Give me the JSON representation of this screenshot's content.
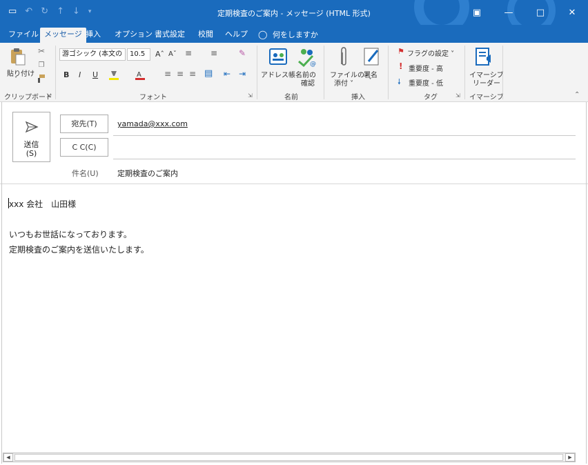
{
  "window": {
    "title": "定期検査のご案内 - メッセージ (HTML 形式)",
    "quick_access": {
      "save_icon": "save-icon",
      "undo_icon": "undo-icon",
      "redo_icon": "redo-icon",
      "up_icon": "arrow-up-icon",
      "down_icon": "arrow-down-icon",
      "customize_icon": "customize-icon"
    },
    "controls": {
      "ribbon_display": "ribbon-display-icon",
      "minimize": "minimize-icon",
      "maximize": "maximize-icon",
      "close": "close-icon"
    }
  },
  "menu": {
    "tabs": [
      {
        "label": "ファイル",
        "active": false
      },
      {
        "label": "メッセージ",
        "active": true
      },
      {
        "label": "挿入",
        "active": false
      },
      {
        "label": "オプション",
        "active": false
      },
      {
        "label": "書式設定",
        "active": false
      },
      {
        "label": "校閲",
        "active": false
      },
      {
        "label": "ヘルプ",
        "active": false
      }
    ],
    "tell_me": "何をしますか"
  },
  "ribbon": {
    "clipboard": {
      "paste": "貼り付け",
      "group": "クリップボード"
    },
    "font": {
      "font_name": "游ゴシック (本文の",
      "font_size": "10.5",
      "bold": "B",
      "italic": "I",
      "underline": "U",
      "group": "フォント"
    },
    "names": {
      "address_book": "アドレス帳",
      "check_names_1": "名前の",
      "check_names_2": "確認",
      "group": "名前"
    },
    "insert": {
      "attach_file_1": "ファイルの",
      "attach_file_2": "添付 ˅",
      "signature_1": "署名",
      "signature_2": "˅",
      "group": "挿入"
    },
    "tags": {
      "follow_up": "フラグの設定 ˅",
      "high_importance": "重要度 - 高",
      "low_importance": "重要度 - 低",
      "group": "タグ"
    },
    "immersive": {
      "reader_1": "イマーシブ",
      "reader_2": "リーダー",
      "group": "イマーシブ"
    }
  },
  "compose": {
    "send_label_1": "送信",
    "send_label_2": "(S)",
    "to_label": "宛先(T)",
    "to_value": "yamada@xxx.com",
    "cc_label": "C C(C)",
    "cc_value": "",
    "subject_label": "件名(U)",
    "subject_value": "定期検査のご案内"
  },
  "body": {
    "lines": [
      "xxx 会社　山田様",
      "",
      "いつもお世話になっております。",
      "定期検査のご案内を送信いたします。"
    ]
  },
  "colors": {
    "title_bar": "#1a6bbd",
    "ribbon": "#f3f3f3",
    "high_importance": "#d32f2f",
    "low_importance": "#1a6bbd",
    "flag": "#d32f2f"
  }
}
